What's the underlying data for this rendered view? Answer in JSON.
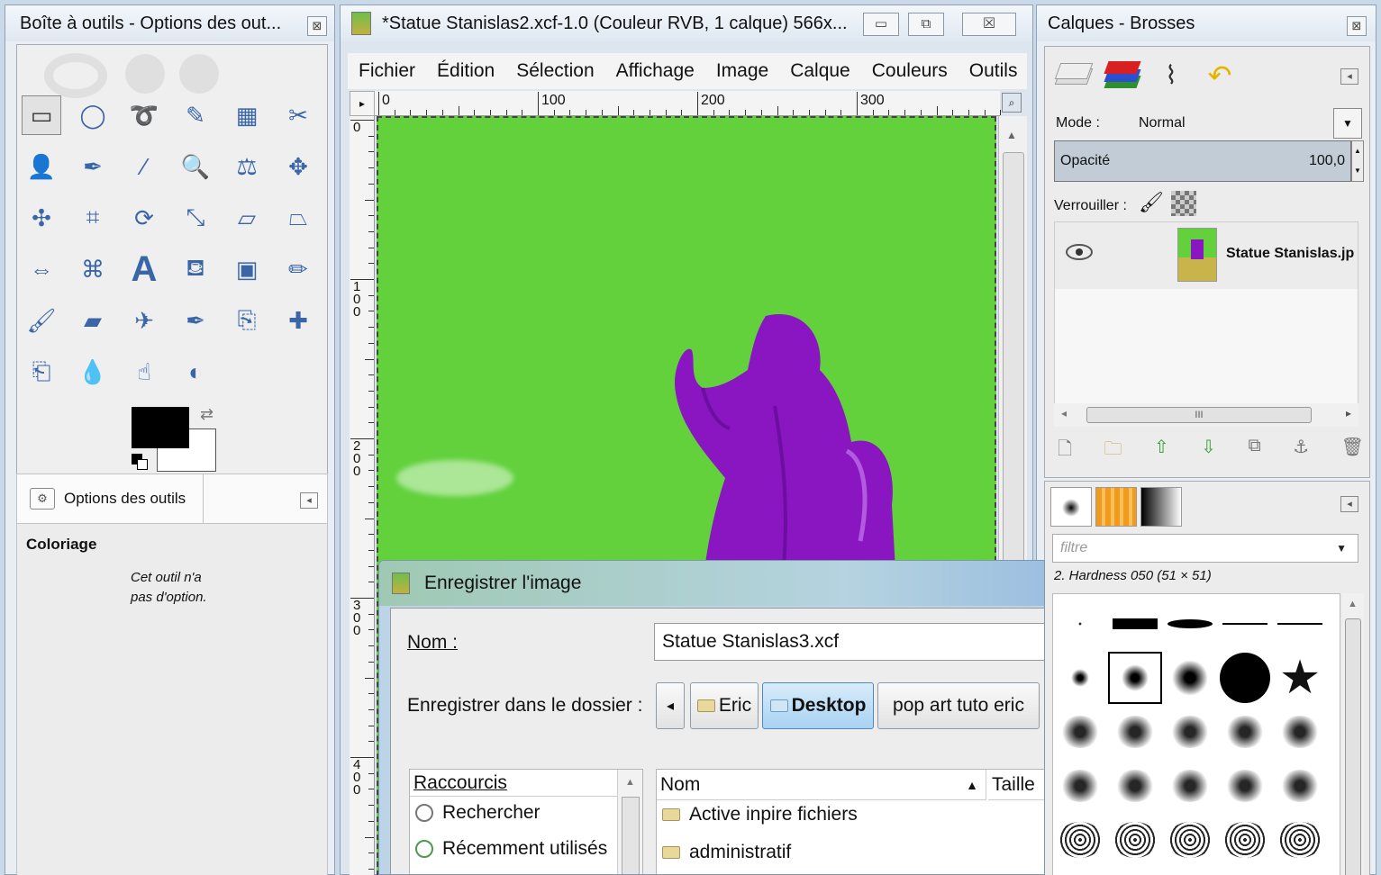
{
  "toolbox": {
    "title": "Boîte à outils - Options des out...",
    "close": "⊠",
    "options_tab": "Options des outils",
    "tool_name": "Coloriage",
    "note_line1": "Cet outil n'a",
    "note_line2": "pas d'option.",
    "fg_color": "#000000",
    "bg_color": "#ffffff",
    "tools": [
      "rect-select-icon",
      "ellipse-select-icon",
      "lasso-icon",
      "fuzzy-select-icon",
      "color-select-icon",
      "scissors-icon",
      "foreground-select-icon",
      "paths-icon",
      "color-picker-icon",
      "zoom-icon",
      "measure-icon",
      "move-icon",
      "align-icon",
      "crop-icon",
      "rotate-icon",
      "scale-icon",
      "shear-icon",
      "perspective-icon",
      "flip-icon",
      "cage-icon",
      "text-icon",
      "bucket-fill-icon",
      "blend-icon",
      "pencil-icon",
      "paintbrush-icon",
      "eraser-icon",
      "airbrush-icon",
      "ink-icon",
      "clone-icon",
      "heal-icon",
      "perspective-clone-icon",
      "blur-icon",
      "smudge-icon",
      "dodge-burn-icon"
    ]
  },
  "image_window": {
    "title": "*Statue Stanislas2.xcf-1.0 (Couleur RVB, 1 calque) 566x...",
    "min": "▭",
    "max": "⧉",
    "close": "☒",
    "menu": [
      "Fichier",
      "Édition",
      "Sélection",
      "Affichage",
      "Image",
      "Calque",
      "Couleurs",
      "Outils"
    ],
    "ruler_top": [
      "0",
      "100",
      "200",
      "300"
    ],
    "ruler_left": [
      "0",
      "100",
      "200",
      "300",
      "400"
    ],
    "canvas_color": "#62d13c",
    "statue_color": "#8a16c2"
  },
  "layers": {
    "title": "Calques - Brosses",
    "close": "⊠",
    "mode_label": "Mode :",
    "mode_value": "Normal",
    "opacity_label": "Opacité",
    "opacity_value": "100,0",
    "lock_label": "Verrouiller :",
    "layer_name": "Statue Stanislas.jp",
    "scroll_mid": "III"
  },
  "brushes": {
    "filter_placeholder": "filtre",
    "brush_name": "2. Hardness 050 (51 × 51)"
  },
  "save_dialog": {
    "title": "Enregistrer l'image",
    "name_label": "Nom :",
    "name_value": "Statue Stanislas3.xcf",
    "folder_label": "Enregistrer dans le dossier :",
    "back": "◂",
    "path": [
      "Eric",
      "Desktop",
      "pop art tuto eric"
    ],
    "shortcuts_header": "Raccourcis",
    "shortcuts": [
      "Rechercher",
      "Récemment utilisés"
    ],
    "col_name": "Nom",
    "col_size": "Taille",
    "sort_arrow": "▲",
    "files": [
      "Active inpire fichiers",
      "administratif"
    ]
  }
}
